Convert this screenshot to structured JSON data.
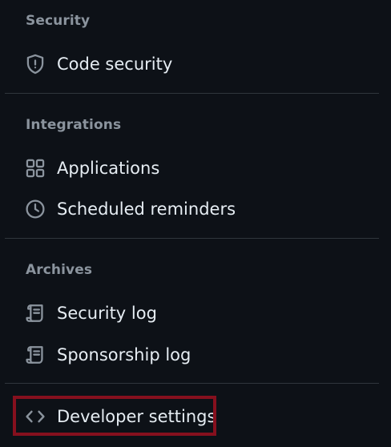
{
  "sections": {
    "security": {
      "heading": "Security",
      "items": [
        {
          "label": "Code security",
          "icon": "shield-icon"
        }
      ]
    },
    "integrations": {
      "heading": "Integrations",
      "items": [
        {
          "label": "Applications",
          "icon": "apps-grid-icon"
        },
        {
          "label": "Scheduled reminders",
          "icon": "clock-icon"
        }
      ]
    },
    "archives": {
      "heading": "Archives",
      "items": [
        {
          "label": "Security log",
          "icon": "log-icon"
        },
        {
          "label": "Sponsorship log",
          "icon": "log-icon"
        }
      ]
    },
    "developer": {
      "items": [
        {
          "label": "Developer settings",
          "icon": "code-icon"
        }
      ]
    }
  },
  "colors": {
    "background": "#0d1117",
    "heading": "#8b949e",
    "text": "#e6edf3",
    "divider": "#30363d",
    "highlight": "#86101e"
  }
}
